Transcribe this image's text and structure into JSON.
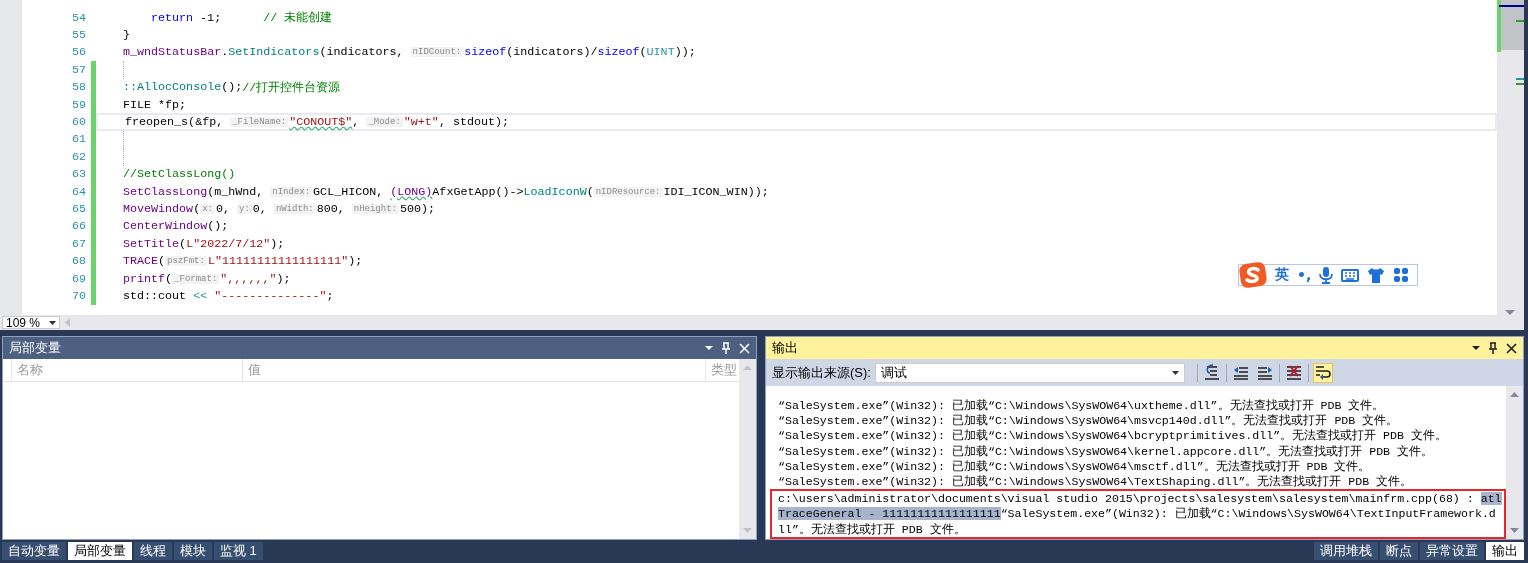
{
  "editor": {
    "lines": [
      {
        "number": "54",
        "nested": true,
        "changed": false,
        "current": false,
        "segments": [
          {
            "kind": "keyword",
            "text": "return"
          },
          {
            "kind": "plain",
            "text": " -1;      "
          },
          {
            "kind": "comment",
            "text": "// 未能创建"
          }
        ]
      },
      {
        "number": "55",
        "nested": false,
        "changed": false,
        "current": false,
        "segments": [
          {
            "kind": "plain",
            "text": "}"
          }
        ]
      },
      {
        "number": "56",
        "nested": false,
        "changed": false,
        "current": false,
        "segments": [
          {
            "kind": "macro",
            "text": "m_wndStatusBar"
          },
          {
            "kind": "plain",
            "text": "."
          },
          {
            "kind": "func",
            "text": "SetIndicators"
          },
          {
            "kind": "plain",
            "text": "(indicators, "
          },
          {
            "kind": "hint",
            "text": "nIDCount:"
          },
          {
            "kind": "keyword",
            "text": "sizeof"
          },
          {
            "kind": "plain",
            "text": "(indicators)/"
          },
          {
            "kind": "keyword",
            "text": "sizeof"
          },
          {
            "kind": "plain",
            "text": "("
          },
          {
            "kind": "type",
            "text": "UINT"
          },
          {
            "kind": "plain",
            "text": "));"
          }
        ]
      },
      {
        "number": "57",
        "nested": false,
        "changed": true,
        "current": false
      },
      {
        "number": "58",
        "nested": false,
        "changed": true,
        "current": false,
        "segments": [
          {
            "kind": "func",
            "text": "::AllocConsole"
          },
          {
            "kind": "plain",
            "text": "();"
          },
          {
            "kind": "comment",
            "text": "//打开控件台资源"
          }
        ]
      },
      {
        "number": "59",
        "nested": false,
        "changed": true,
        "current": false,
        "segments": [
          {
            "kind": "plain",
            "text": "FILE *fp;"
          }
        ]
      },
      {
        "number": "60",
        "nested": false,
        "changed": true,
        "current": true,
        "segments": [
          {
            "kind": "plain",
            "text": "freopen_s(&fp, "
          },
          {
            "kind": "hint",
            "text": "_FileName:"
          },
          {
            "kind": "string",
            "text": "\"CONOUT$\"",
            "squiggle": true
          },
          {
            "kind": "plain",
            "text": ", "
          },
          {
            "kind": "hint",
            "text": "_Mode:"
          },
          {
            "kind": "string",
            "text": "\"w+t\""
          },
          {
            "kind": "plain",
            "text": ", stdout);"
          }
        ]
      },
      {
        "number": "61",
        "nested": false,
        "changed": true,
        "current": false
      },
      {
        "number": "62",
        "nested": false,
        "changed": true,
        "current": false
      },
      {
        "number": "63",
        "nested": false,
        "changed": true,
        "current": false,
        "segments": [
          {
            "kind": "comment",
            "text": "//SetClassLong()"
          }
        ]
      },
      {
        "number": "64",
        "nested": false,
        "changed": true,
        "current": false,
        "segments": [
          {
            "kind": "macro",
            "text": "SetClassLong"
          },
          {
            "kind": "plain",
            "text": "(m_hWnd, "
          },
          {
            "kind": "hint",
            "text": "nIndex:"
          },
          {
            "kind": "plain",
            "text": "GCL_HICON, "
          },
          {
            "kind": "macro",
            "text": "(LONG)",
            "squiggle": true
          },
          {
            "kind": "plain",
            "text": "AfxGetApp()->"
          },
          {
            "kind": "func",
            "text": "LoadIconW"
          },
          {
            "kind": "plain",
            "text": "("
          },
          {
            "kind": "hint",
            "text": "nIDResource:"
          },
          {
            "kind": "plain",
            "text": "IDI_ICON_WIN));"
          }
        ]
      },
      {
        "number": "65",
        "nested": false,
        "changed": true,
        "current": false,
        "segments": [
          {
            "kind": "macro",
            "text": "MoveWindow"
          },
          {
            "kind": "plain",
            "text": "("
          },
          {
            "kind": "hint",
            "text": "x:"
          },
          {
            "kind": "plain",
            "text": "0, "
          },
          {
            "kind": "hint",
            "text": "y:"
          },
          {
            "kind": "plain",
            "text": "0, "
          },
          {
            "kind": "hint",
            "text": "nWidth:"
          },
          {
            "kind": "plain",
            "text": "800, "
          },
          {
            "kind": "hint",
            "text": "nHeight:"
          },
          {
            "kind": "plain",
            "text": "500);"
          }
        ]
      },
      {
        "number": "66",
        "nested": false,
        "changed": true,
        "current": false,
        "segments": [
          {
            "kind": "macro",
            "text": "CenterWindow"
          },
          {
            "kind": "plain",
            "text": "();"
          }
        ]
      },
      {
        "number": "67",
        "nested": false,
        "changed": true,
        "current": false,
        "segments": [
          {
            "kind": "macro",
            "text": "SetTitle"
          },
          {
            "kind": "plain",
            "text": "("
          },
          {
            "kind": "string",
            "text": "L\"2022/7/12\""
          },
          {
            "kind": "plain",
            "text": ");"
          }
        ]
      },
      {
        "number": "68",
        "nested": false,
        "changed": true,
        "current": false,
        "segments": [
          {
            "kind": "macro",
            "text": "TRACE"
          },
          {
            "kind": "plain",
            "text": "("
          },
          {
            "kind": "hint",
            "text": "pszFmt:"
          },
          {
            "kind": "string",
            "text": "L\"11111111111111111\""
          },
          {
            "kind": "plain",
            "text": ");"
          }
        ]
      },
      {
        "number": "69",
        "nested": false,
        "changed": true,
        "current": false,
        "segments": [
          {
            "kind": "macro",
            "text": "printf"
          },
          {
            "kind": "plain",
            "text": "("
          },
          {
            "kind": "hint",
            "text": "_Format:"
          },
          {
            "kind": "string",
            "text": "\",,,,,,\""
          },
          {
            "kind": "plain",
            "text": ");"
          }
        ]
      },
      {
        "number": "70",
        "nested": false,
        "changed": true,
        "current": false,
        "segments": [
          {
            "kind": "plain",
            "text": "std::cout "
          },
          {
            "kind": "type",
            "text": "<< "
          },
          {
            "kind": "string",
            "text": "\"--------------\""
          },
          {
            "kind": "plain",
            "text": ";"
          }
        ]
      }
    ],
    "zoom": "109 %"
  },
  "ime_bar": {
    "mode": "英",
    "punctuation": "•,"
  },
  "locals": {
    "title": "局部变量",
    "columns": [
      "名称",
      "值",
      "类型"
    ]
  },
  "output": {
    "title": "输出",
    "source_label": "显示输出来源(S):",
    "source": "调试",
    "tools": [
      {
        "kind": "find",
        "on": false
      },
      {
        "kind": "prev",
        "on": false
      },
      {
        "kind": "next",
        "on": false
      },
      {
        "kind": "clear",
        "on": false
      },
      {
        "kind": "wrap",
        "on": true
      }
    ],
    "lines": [
      {
        "kind": "line",
        "text": "“SaleSystem.exe”(Win32): 已加载“C:\\Windows\\SysWOW64\\uxtheme.dll”。无法查找或打开 PDB 文件。"
      },
      {
        "kind": "line",
        "text": "“SaleSystem.exe”(Win32): 已加载“C:\\Windows\\SysWOW64\\msvcp140d.dll”。无法查找或打开 PDB 文件。"
      },
      {
        "kind": "line",
        "text": "“SaleSystem.exe”(Win32): 已加载“C:\\Windows\\SysWOW64\\bcryptprimitives.dll”。无法查找或打开 PDB 文件。"
      },
      {
        "kind": "line",
        "text": "“SaleSystem.exe”(Win32): 已加载“C:\\Windows\\SysWOW64\\kernel.appcore.dll”。无法查找或打开 PDB 文件。"
      },
      {
        "kind": "line",
        "text": "“SaleSystem.exe”(Win32): 已加载“C:\\Windows\\SysWOW64\\msctf.dll”。无法查找或打开 PDB 文件。"
      },
      {
        "kind": "line",
        "text": "“SaleSystem.exe”(Win32): 已加载“C:\\Windows\\SysWOW64\\TextShaping.dll”。无法查找或打开 PDB 文件。"
      },
      {
        "kind": "boxed",
        "segments": [
          {
            "text": "c:\\users\\administrator\\documents\\visual studio 2015\\projects\\salesystem\\salesystem\\mainfrm.cpp(68) : ",
            "selected": false
          },
          {
            "text": "atlTraceGeneral - 11111111111111111",
            "selected": true
          },
          {
            "text": "“SaleSystem.exe”(Win32): 已加载“C:\\Windows\\SysWOW64\\TextInputFramework.dll”。无法查找或打开 PDB 文件。",
            "selected": false
          }
        ]
      }
    ]
  },
  "left_tabs": [
    {
      "label": "自动变量",
      "selected": false
    },
    {
      "label": "局部变量",
      "selected": true
    },
    {
      "label": "线程",
      "selected": false
    },
    {
      "label": "模块",
      "selected": false
    },
    {
      "label": "监视 1",
      "selected": false
    }
  ],
  "right_tabs": [
    {
      "label": "调用堆栈",
      "selected": false
    },
    {
      "label": "断点",
      "selected": false
    },
    {
      "label": "异常设置",
      "selected": false
    },
    {
      "label": "输出",
      "selected": true
    }
  ]
}
